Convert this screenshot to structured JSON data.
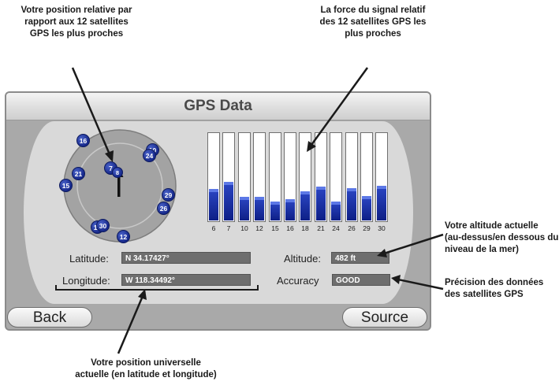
{
  "annotations": {
    "position_relative": [
      "Votre position relative par",
      "rapport aux 12 satellites",
      "GPS les plus proches"
    ],
    "signal_strength": [
      "La force du signal relatif",
      "des 12 satellites GPS les",
      "plus proches"
    ],
    "altitude": [
      "Votre altitude actuelle",
      "(au-dessus/en dessous du",
      "niveau de la mer)"
    ],
    "accuracy": [
      "Précision des données",
      "des satellites GPS"
    ],
    "universal_position": [
      "Votre position universelle",
      "actuelle (en latitude et longitude)"
    ]
  },
  "screen": {
    "title": "GPS Data",
    "latitude_label": "Latitude:",
    "latitude_value": "N 34.17427°",
    "longitude_label": "Longitude:",
    "longitude_value": "W 118.34492°",
    "altitude_label": "Altitude:",
    "altitude_value": "482 ft",
    "accuracy_label": "Accuracy",
    "accuracy_value": "GOOD",
    "back_label": "Back",
    "source_label": "Source"
  },
  "satellites": [
    "16",
    "10",
    "24",
    "21",
    "7",
    "8",
    "15",
    "29",
    "26",
    "18",
    "30",
    "12"
  ],
  "chart_data": {
    "type": "bar",
    "categories": [
      "6",
      "7",
      "10",
      "12",
      "15",
      "16",
      "18",
      "21",
      "24",
      "26",
      "29",
      "30"
    ],
    "values": [
      36,
      44,
      27,
      27,
      21,
      24,
      33,
      38,
      21,
      37,
      28,
      39
    ],
    "ylim": [
      0,
      100
    ],
    "grid": false
  },
  "colors": {
    "bar_fill": "#1a2fa8",
    "satellite": "#1c2f94",
    "panel": "#d9d9d9",
    "value_box": "#6e6e6e"
  }
}
